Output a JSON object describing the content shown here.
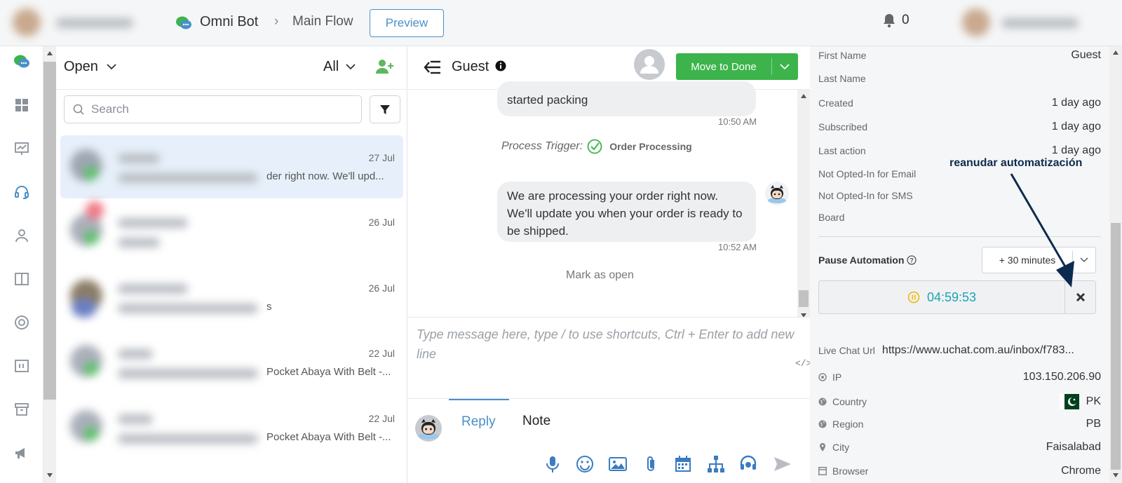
{
  "topbar": {
    "bot_name": "Omni Bot",
    "flow_name": "Main Flow",
    "preview_label": "Preview",
    "notification_count": "0"
  },
  "list": {
    "status_filter": "Open",
    "scope_filter": "All",
    "search_placeholder": "Search",
    "items": [
      {
        "date": "27 Jul",
        "preview": "der right now. We'll upd..."
      },
      {
        "date": "26 Jul",
        "preview": ""
      },
      {
        "date": "26 Jul",
        "preview": "s"
      },
      {
        "date": "22 Jul",
        "preview": "Pocket Abaya With Belt -..."
      },
      {
        "date": "22 Jul",
        "preview": "Pocket Abaya With Belt -..."
      }
    ]
  },
  "chat": {
    "contact_name": "Guest",
    "move_done_label": "Move to Done",
    "msg1_text": "started packing",
    "msg1_time": "10:50 AM",
    "trigger_prefix": "Process Trigger:",
    "trigger_name": "Order Processing",
    "msg2_text": "We are processing your order right now. We'll update you when your order is ready to be shipped.",
    "msg2_time": "10:52 AM",
    "mark_open_label": "Mark as open",
    "composer_placeholder": "Type message here, type / to use shortcuts, Ctrl + Enter to add new line",
    "tab_reply": "Reply",
    "tab_note": "Note"
  },
  "profile": {
    "fields": [
      {
        "label": "First Name",
        "value": "Guest"
      },
      {
        "label": "Last Name",
        "value": ""
      },
      {
        "label": "Created",
        "value": "1 day ago"
      },
      {
        "label": "Subscribed",
        "value": "1 day ago"
      },
      {
        "label": "Last action",
        "value": "1 day ago"
      },
      {
        "label": "Not Opted-In for Email",
        "value": ""
      },
      {
        "label": "Not Opted-In for SMS",
        "value": ""
      },
      {
        "label": "Board",
        "value": ""
      }
    ],
    "pause_label": "Pause Automation",
    "pause_option": "+ 30 minutes",
    "timer": "04:59:53",
    "live_chat_label": "Live Chat Url",
    "live_chat_value": "https://www.uchat.com.au/inbox/f783...",
    "ip_label": "IP",
    "ip_value": "103.150.206.90",
    "country_label": "Country",
    "country_value": "PK",
    "region_label": "Region",
    "region_value": "PB",
    "city_label": "City",
    "city_value": "Faisalabad",
    "browser_label": "Browser",
    "browser_value": "Chrome"
  },
  "annotation": {
    "text": "reanudar automatización"
  },
  "colors": {
    "accent": "#4a90c9",
    "done_green": "#3cb44b",
    "timer_teal": "#1aa5b5",
    "annotation_navy": "#0d2b4e"
  }
}
